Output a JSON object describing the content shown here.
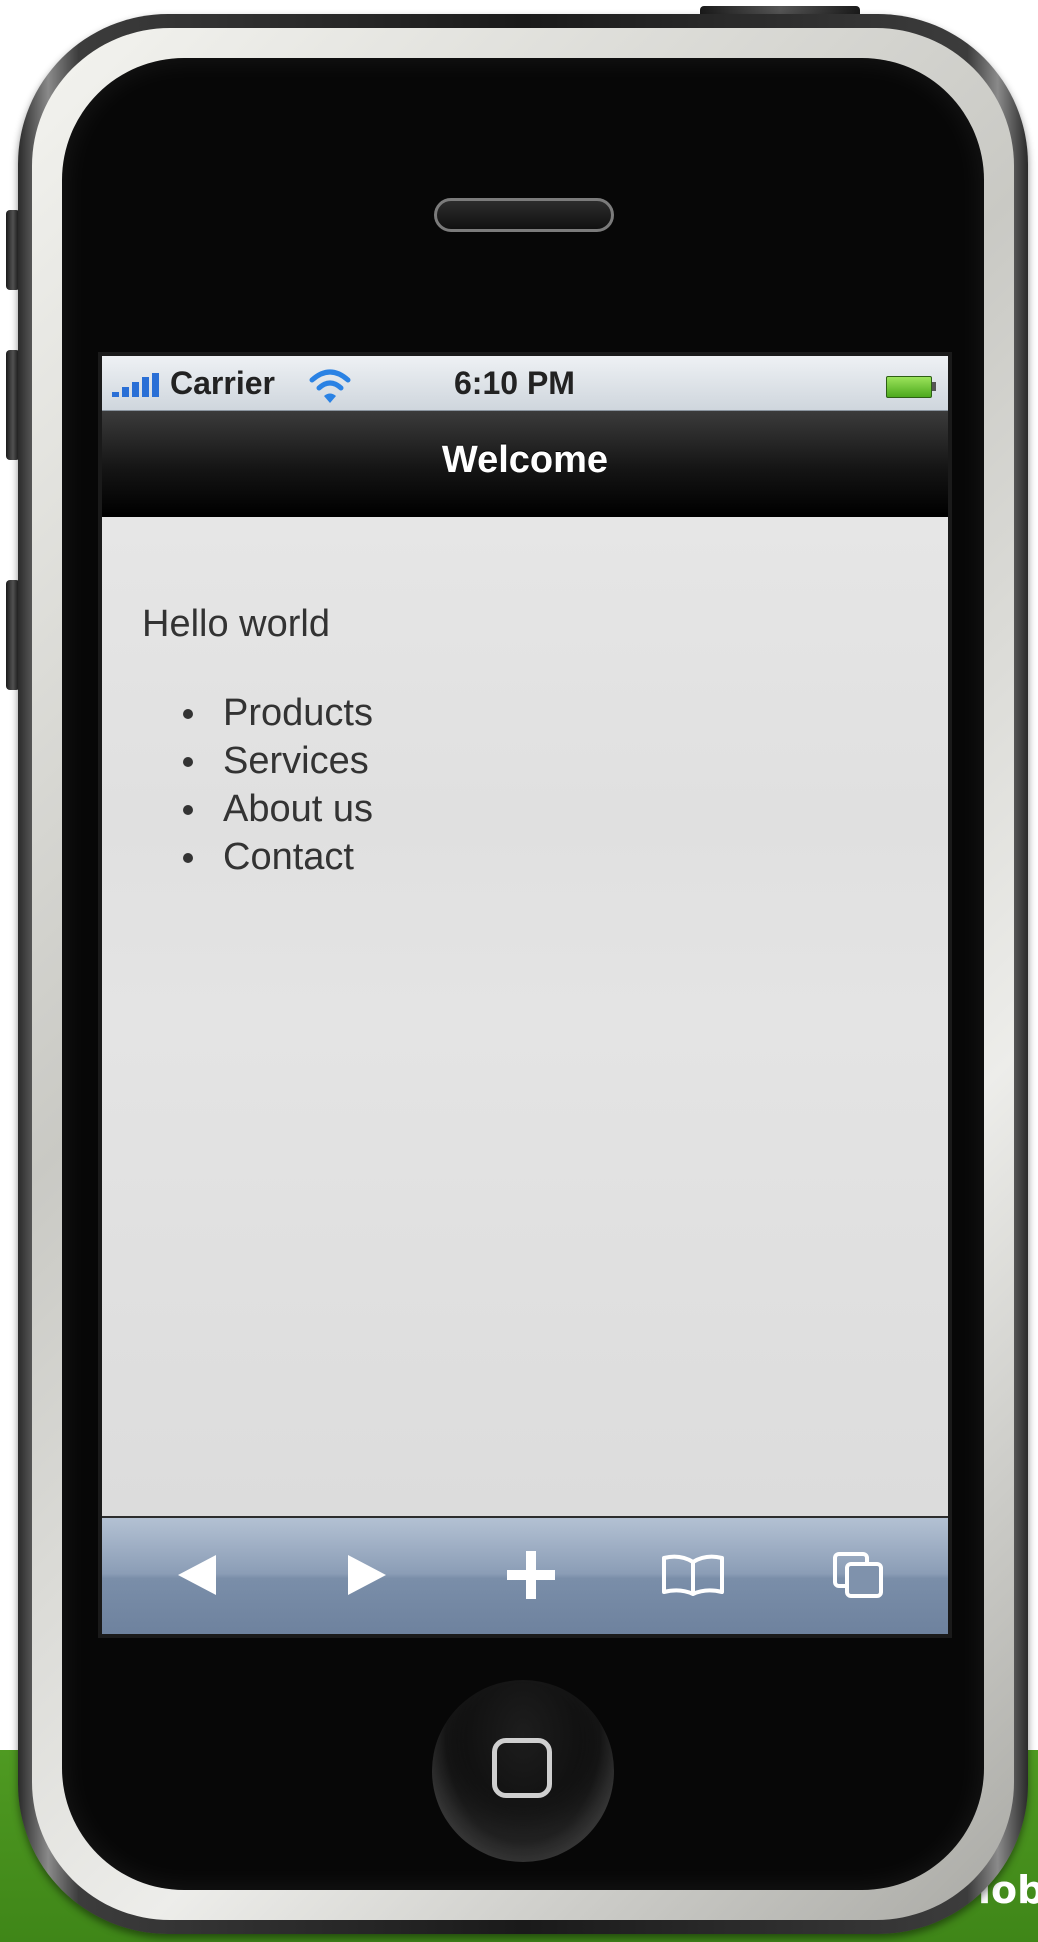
{
  "background_band": {
    "text": "lob",
    "color": "#4a9420"
  },
  "status_bar": {
    "carrier": "Carrier",
    "time": "6:10 PM",
    "signal_icon": "signal-bars-icon",
    "wifi_icon": "wifi-icon",
    "battery_icon": "battery-full-icon"
  },
  "nav_bar": {
    "title": "Welcome"
  },
  "content": {
    "greeting": "Hello world",
    "menu_items": [
      "Products",
      "Services",
      "About us",
      "Contact"
    ]
  },
  "toolbar": {
    "buttons": [
      "back-arrow-icon",
      "forward-arrow-icon",
      "add-plus-icon",
      "bookmarks-book-icon",
      "pages-icon"
    ]
  },
  "colors": {
    "accent": "#2a6fd6",
    "navbar": "#151515",
    "toolbar": "#8b9db6",
    "content_bg": "#dfdfdf"
  }
}
